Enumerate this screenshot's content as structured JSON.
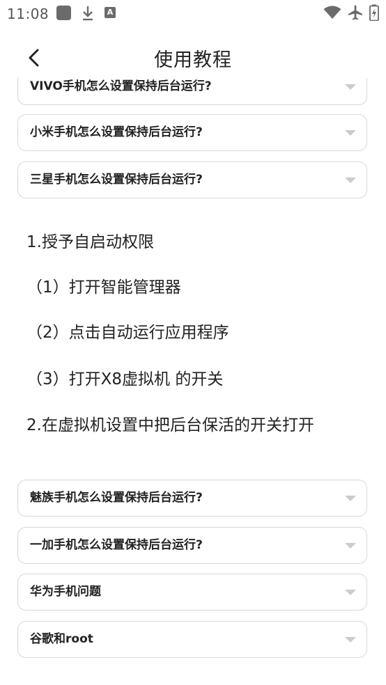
{
  "status_bar": {
    "time": "11:08",
    "a_badge": "A"
  },
  "header": {
    "title": "使用教程"
  },
  "accordion": {
    "items": [
      {
        "label": "VIVO手机怎么设置保持后台运行?"
      },
      {
        "label": "小米手机怎么设置保持后台运行?"
      },
      {
        "label": "三星手机怎么设置保持后台运行?"
      },
      {
        "label": "魅族手机怎么设置保持后台运行?"
      },
      {
        "label": "一加手机怎么设置保持后台运行?"
      },
      {
        "label": "华为手机问题"
      },
      {
        "label": "谷歌和root"
      }
    ]
  },
  "expanded": {
    "step1": "1.授予自启动权限",
    "sub1": "（1）打开智能管理器",
    "sub2": "（2）点击自动运行应用程序",
    "sub3": "（3）打开X8虚拟机 的开关",
    "step2": "2.在虚拟机设置中把后台保活的开关打开"
  },
  "colors": {
    "border": "#d8d8d8",
    "chevron": "#cccccc",
    "text": "#222222",
    "status_icon": "#6b6b6b"
  }
}
